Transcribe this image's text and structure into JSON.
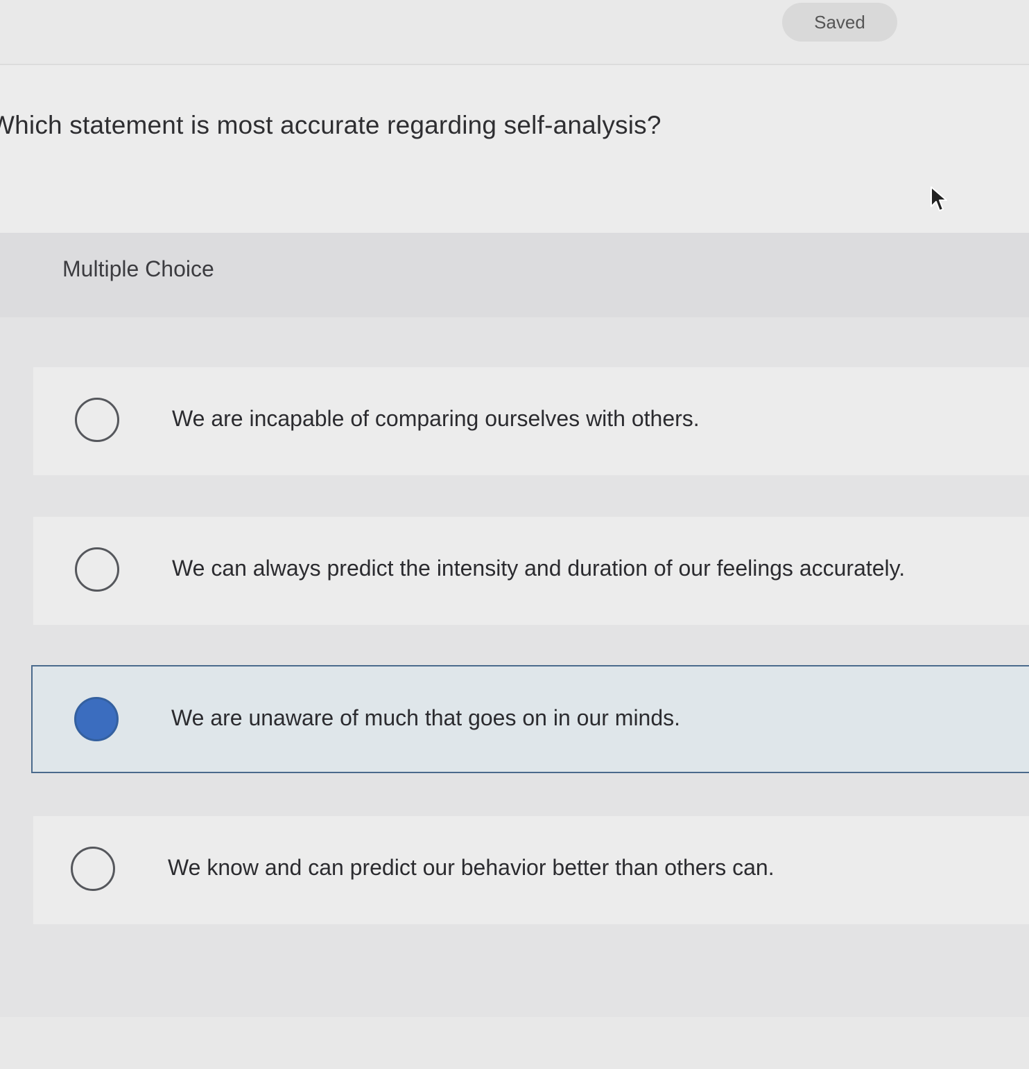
{
  "header": {
    "saved_label": "Saved"
  },
  "question": {
    "text": "Which statement is most accurate regarding self-analysis?"
  },
  "section": {
    "label": "Multiple Choice"
  },
  "options": [
    {
      "text": "We are incapable of comparing ourselves with others.",
      "selected": false
    },
    {
      "text": "We can always predict the intensity and duration of our feelings accurately.",
      "selected": false
    },
    {
      "text": "We are unaware of much that goes on in our minds.",
      "selected": true
    },
    {
      "text": "We know and can predict our behavior better than others can.",
      "selected": false
    }
  ],
  "colors": {
    "selected_radio": "#3b6dbf",
    "selected_border": "#4a6a8c",
    "selected_background": "#dfe6ea"
  },
  "icons": {
    "cursor": "mouse-pointer-icon"
  }
}
